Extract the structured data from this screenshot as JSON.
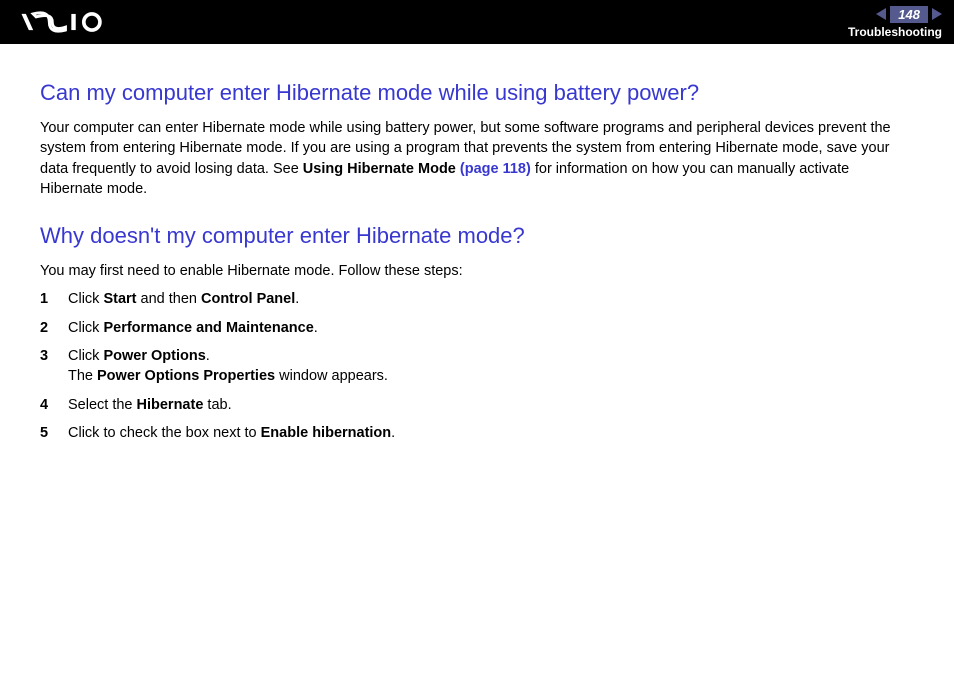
{
  "header": {
    "page_number": "148",
    "section": "Troubleshooting"
  },
  "content": {
    "q1": {
      "heading": "Can my computer enter Hibernate mode while using battery power?",
      "para_before": "Your computer can enter Hibernate mode while using battery power, but some software programs and peripheral devices prevent the system from entering Hibernate mode. If you are using a program that prevents the system from entering Hibernate mode, save your data frequently to avoid losing data. See ",
      "link_bold": "Using Hibernate Mode ",
      "link_page": "(page 118)",
      "para_after": " for information on how you can manually activate Hibernate mode."
    },
    "q2": {
      "heading": "Why doesn't my computer enter Hibernate mode?",
      "intro": "You may first need to enable Hibernate mode. Follow these steps:",
      "steps": [
        {
          "num": "1",
          "pre": "Click ",
          "b1": "Start",
          "mid": " and then ",
          "b2": "Control Panel",
          "post": "."
        },
        {
          "num": "2",
          "pre": "Click ",
          "b1": "Performance and Maintenance",
          "post": "."
        },
        {
          "num": "3",
          "pre": "Click ",
          "b1": "Power Options",
          "post": ".",
          "line2_pre": "The ",
          "line2_b": "Power Options Properties",
          "line2_post": " window appears."
        },
        {
          "num": "4",
          "pre": "Select the ",
          "b1": "Hibernate",
          "post": " tab."
        },
        {
          "num": "5",
          "pre": "Click to check the box next to ",
          "b1": "Enable hibernation",
          "post": "."
        }
      ]
    }
  }
}
